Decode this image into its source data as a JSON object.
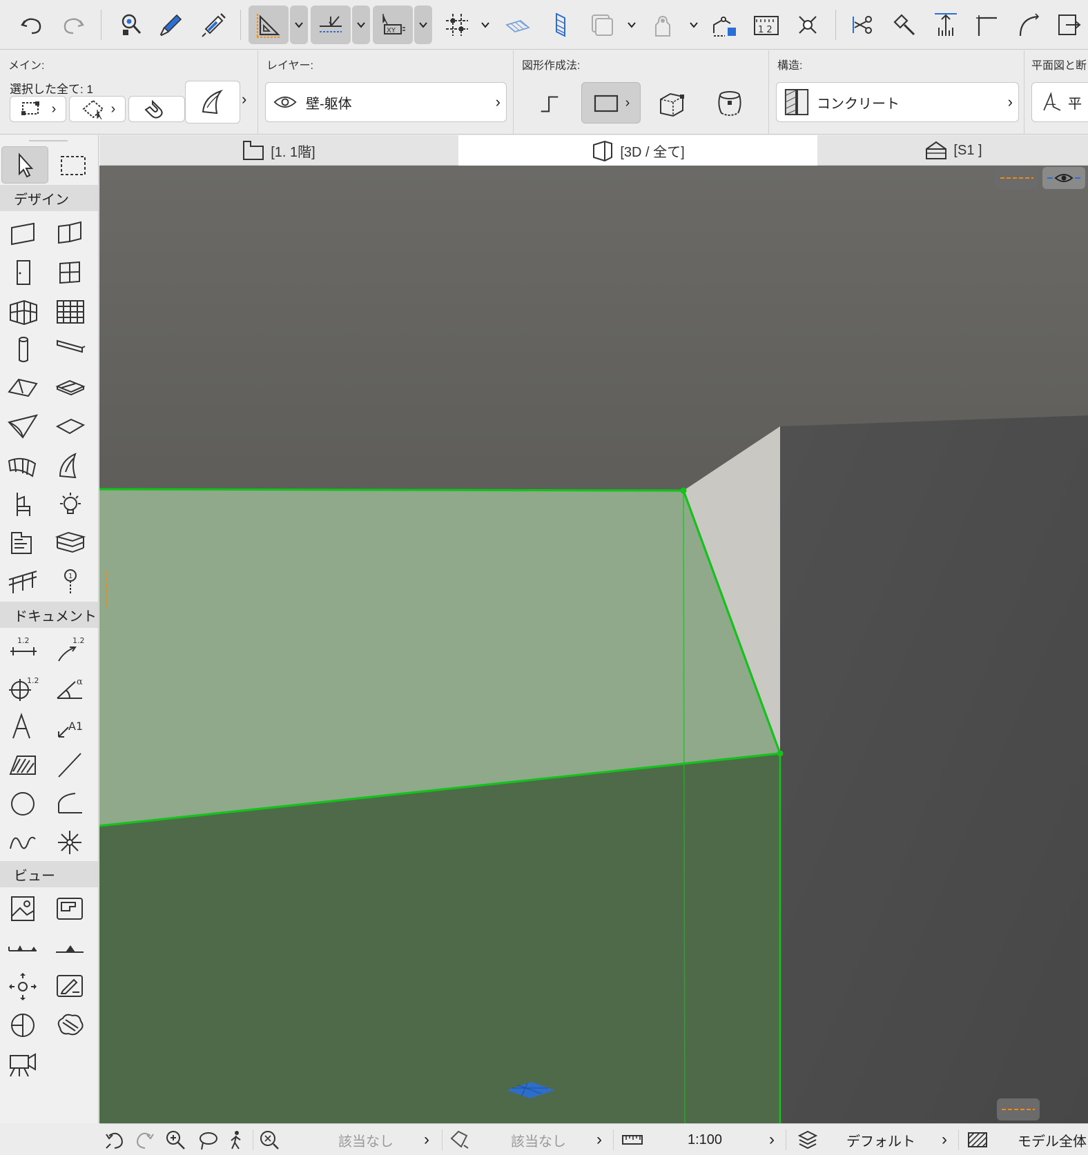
{
  "toolbar": {
    "icons": [
      "undo-icon",
      "redo-icon",
      "find-select-icon",
      "eyedropper-icon",
      "syringe-icon",
      "guide-lines-icon",
      "snap-guides-icon",
      "coordinate-input-icon",
      "snap-points-icon",
      "fill-plane-icon",
      "trace-icon",
      "trace-reference-icon",
      "show-hide-icon",
      "renovation-icon",
      "dimension-icon",
      "intersect-icon",
      "split-icon",
      "adjust-icon",
      "elevate-icon",
      "fillet-icon",
      "curve-icon",
      "resize-icon"
    ]
  },
  "infobox": {
    "main": {
      "title": "メイン:",
      "selection": "選択した全て: 1"
    },
    "layer": {
      "title": "レイヤー:",
      "value": "壁-躯体"
    },
    "geometry": {
      "title": "図形作成法:"
    },
    "structure": {
      "title": "構造:",
      "value": "コンクリート"
    },
    "floorplan": {
      "title": "平面図と断",
      "value": "平"
    }
  },
  "tabs": [
    {
      "label": "[1. 1階]",
      "icon": "floor-plan-icon"
    },
    {
      "label": "[3D / 全て]",
      "icon": "3d-view-icon",
      "active": true
    },
    {
      "label": "[S1 ]",
      "icon": "section-icon"
    }
  ],
  "toolbox": {
    "design_label": "デザイン",
    "document_label": "ドキュメント",
    "view_label": "ビュー",
    "design_tools": [
      "wall-tool-icon",
      "curtain-panel-icon",
      "door-tool-icon",
      "window-tool-icon",
      "curtain-wall-icon",
      "grid-system-icon",
      "column-tool-icon",
      "beam-tool-icon",
      "roof-tool-icon",
      "slab-tool-icon",
      "shell-tool-icon",
      "mesh-tool-icon",
      "morph-surface-icon",
      "morph-tool-icon",
      "object-tool-icon",
      "lamp-tool-icon",
      "zone-tool-icon",
      "stair-tool-icon",
      "railing-tool-icon",
      "marker-tool-icon"
    ],
    "document_tools": [
      "linear-dimension-icon",
      "radial-dimension-icon",
      "level-dimension-icon",
      "angle-dimension-icon",
      "text-tool-icon",
      "label-tool-icon",
      "fill-tool-icon",
      "line-tool-icon",
      "circle-tool-icon",
      "arc-tool-icon",
      "spline-tool-icon",
      "hotspot-tool-icon"
    ],
    "view_tools": [
      "figure-tool-icon",
      "drawing-tool-icon",
      "section-tool-icon",
      "elevation-tool-icon",
      "interior-elevation-icon",
      "worksheet-tool-icon",
      "detail-tool-icon",
      "change-tool-icon",
      "camera-tool-icon"
    ]
  },
  "statusbar": {
    "undo_view_icon": "undo-view-icon",
    "redo_view_icon": "redo-view-icon",
    "zoom_icon": "zoom-icon",
    "orbit_icon": "orbit-icon",
    "walk_icon": "walk-icon",
    "fit_icon": "fit-in-window-icon",
    "view_option_1": "該当なし",
    "view_option_2": "該当なし",
    "scale": "1:100",
    "layer_combo": "デフォルト",
    "model_filter": "モデル全体"
  },
  "colors": {
    "viewport_bg_top": "#6b6a66",
    "viewport_bg_bottom": "#4a4a48",
    "selection_green": "#13c21b",
    "wall_top_fill": "#8ea889",
    "wall_face_fill": "#4e6a48",
    "accent_orange": "#f08a12",
    "accent_blue": "#2b6fd6"
  }
}
